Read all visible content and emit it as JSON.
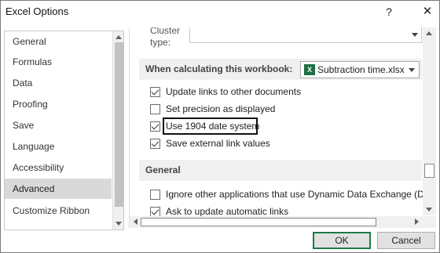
{
  "window": {
    "title": "Excel Options",
    "help_glyph": "?",
    "close_glyph": "✕"
  },
  "sidebar": {
    "items": [
      {
        "label": "General"
      },
      {
        "label": "Formulas"
      },
      {
        "label": "Data"
      },
      {
        "label": "Proofing"
      },
      {
        "label": "Save"
      },
      {
        "label": "Language"
      },
      {
        "label": "Accessibility"
      },
      {
        "label": "Advanced",
        "active": true
      },
      {
        "label": "Customize Ribbon"
      }
    ]
  },
  "main": {
    "cluster_label_line1": "Cluster",
    "cluster_label_line2": "type:",
    "calc_section": {
      "title": "When calculating this workbook:",
      "workbook": "Subtraction time.xlsx",
      "workbook_icon": "X",
      "options": [
        {
          "label": "Update links to other documents",
          "checked": true
        },
        {
          "label": "Set precision as displayed",
          "checked": false
        },
        {
          "label": "Use 1904 date system",
          "checked": true
        },
        {
          "label": "Save external link values",
          "checked": true
        }
      ]
    },
    "general_section": {
      "title": "General",
      "options": [
        {
          "label": "Ignore other applications that use Dynamic Data Exchange (DDE)",
          "checked": false
        },
        {
          "label": "Ask to update automatic links",
          "checked": true
        }
      ]
    }
  },
  "footer": {
    "ok_label": "OK",
    "cancel_label": "Cancel"
  }
}
